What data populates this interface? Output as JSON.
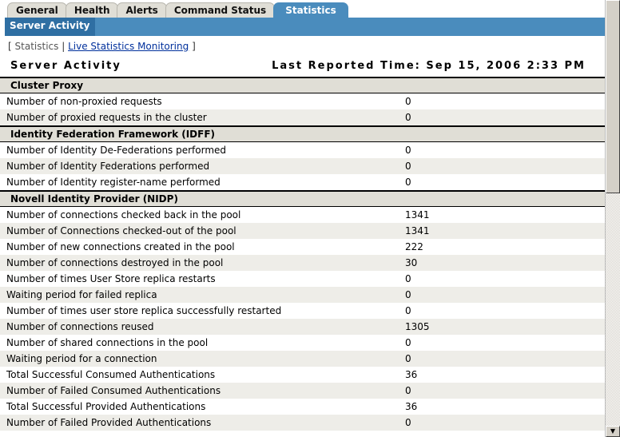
{
  "tabs": [
    "General",
    "Health",
    "Alerts",
    "Command Status",
    "Statistics"
  ],
  "subheader": "Server Activity",
  "links": {
    "current": "Statistics",
    "separator": "|",
    "live": "Live Statistics Monitoring",
    "open": "[",
    "close": "]"
  },
  "title": "Server Activity",
  "last_reported": "Last Reported Time: Sep 15, 2006 2:33 PM",
  "sections": [
    {
      "name": "Cluster Proxy",
      "rows": [
        [
          "Number of non-proxied requests",
          "0"
        ],
        [
          "Number of proxied requests in the cluster",
          "0"
        ]
      ]
    },
    {
      "name": "Identity Federation Framework (IDFF)",
      "rows": [
        [
          "Number of Identity De-Federations performed",
          "0"
        ],
        [
          "Number of Identity Federations performed",
          "0"
        ],
        [
          "Number of Identity register-name performed",
          "0"
        ]
      ]
    },
    {
      "name": "Novell Identity Provider (NIDP)",
      "rows": [
        [
          "Number of connections checked back in the pool",
          "1341"
        ],
        [
          "Number of Connections checked-out of the pool",
          "1341"
        ],
        [
          "Number of new connections created in the pool",
          "222"
        ],
        [
          "Number of connections destroyed in the pool",
          "30"
        ],
        [
          "Number of times User Store replica restarts",
          "0"
        ],
        [
          "Waiting period for failed replica",
          "0"
        ],
        [
          "Number of times user store replica successfully restarted",
          "0"
        ],
        [
          "Number of connections reused",
          "1305"
        ],
        [
          "Number of shared connections in the pool",
          "0"
        ],
        [
          "Waiting period for a connection",
          "0"
        ],
        [
          "Total Successful Consumed Authentications",
          "36"
        ],
        [
          "Number of Failed Consumed Authentications",
          "0"
        ],
        [
          "Total Successful Provided Authentications",
          "36"
        ],
        [
          "Number of Failed Provided Authentications",
          "0"
        ]
      ]
    }
  ]
}
